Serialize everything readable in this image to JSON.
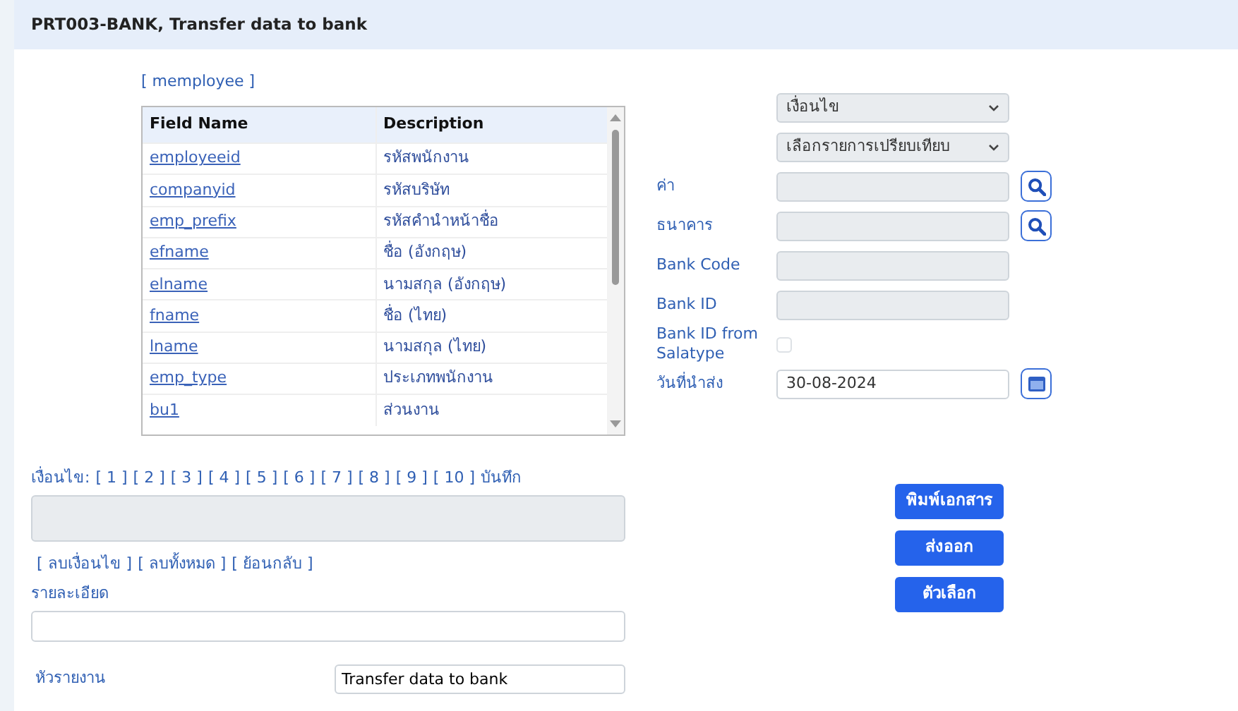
{
  "window": {
    "title": "PRT003-BANK, Transfer data to bank"
  },
  "table": {
    "name": "[ memployee ]",
    "columns": [
      "Field Name",
      "Description"
    ],
    "rows": [
      {
        "field": "employeeid",
        "description": "รหัสพนักงาน"
      },
      {
        "field": "companyid",
        "description": "รหัสบริษัท"
      },
      {
        "field": "emp_prefix",
        "description": "รหัสคำนำหน้าชื่อ"
      },
      {
        "field": "efname",
        "description": "ชื่อ (อังกฤษ)"
      },
      {
        "field": "elname",
        "description": "นามสกุล (อังกฤษ)"
      },
      {
        "field": "fname",
        "description": "ชื่อ (ไทย)"
      },
      {
        "field": "lname",
        "description": "นามสกุล (ไทย)"
      },
      {
        "field": "emp_type",
        "description": "ประเภทพนักงาน"
      },
      {
        "field": "bu1",
        "description": "ส่วนงาน"
      }
    ]
  },
  "filters": [
    {
      "kind": "select",
      "value": "เงื่อนไข",
      "disabled": true
    },
    {
      "kind": "select",
      "value": "เลือกรายการเปรียบเทียบ",
      "disabled": true
    },
    {
      "kind": "lookup",
      "label": "ค่า",
      "disabled": true
    },
    {
      "kind": "lookup",
      "label": "ธนาคาร",
      "disabled": true
    },
    {
      "kind": "text",
      "label": "Bank Code",
      "disabled": true
    },
    {
      "kind": "text",
      "label": "Bank ID",
      "disabled": true
    },
    {
      "kind": "checkbox",
      "label": "Bank ID from Salatype",
      "checked": false
    },
    {
      "kind": "date",
      "label": "วันที่นำส่ง",
      "value": "30-08-2024",
      "disabled": false
    }
  ],
  "conditions": {
    "label": "เงื่อนไข:",
    "slots": [
      "[ 1 ]",
      "[ 2 ]",
      "[ 3 ]",
      "[ 4 ]",
      "[ 5 ]",
      "[ 6 ]",
      "[ 7 ]",
      "[ 8 ]",
      "[ 9 ]",
      "[ 10 ]"
    ],
    "save": "บันทึก",
    "disabled": true
  },
  "condition_actions": [
    "[ ลบเงื่อนไข ]",
    "[ ลบทั้งหมด ]",
    "[ ย้อนกลับ ]"
  ],
  "details": {
    "label": "รายละเอียด"
  },
  "report_title": {
    "label": "หัวรายงาน",
    "value": "Transfer data to bank"
  },
  "buttons": [
    "พิมพ์เอกสาร",
    "ส่งออก",
    "ตัวเลือก"
  ]
}
